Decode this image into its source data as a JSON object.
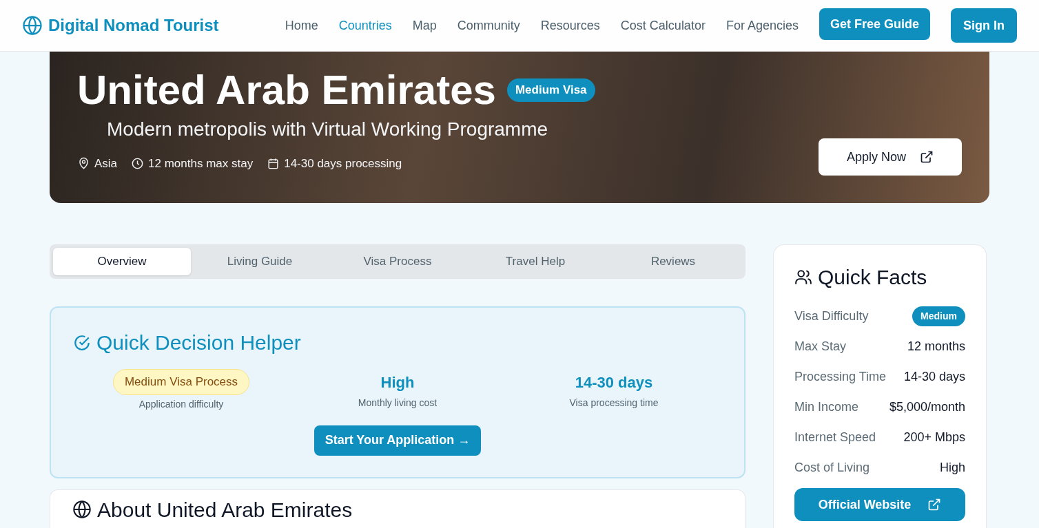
{
  "header": {
    "brand": "Digital Nomad Tourist",
    "nav": [
      {
        "label": "Home",
        "selected": false
      },
      {
        "label": "Countries",
        "selected": true
      },
      {
        "label": "Map",
        "selected": false
      },
      {
        "label": "Community",
        "selected": false
      },
      {
        "label": "Resources",
        "selected": false
      },
      {
        "label": "Cost Calculator",
        "selected": false
      },
      {
        "label": "For Agencies",
        "selected": false
      }
    ],
    "buttons": [
      "Get Free Guide",
      "Sign In"
    ]
  },
  "hero": {
    "title": "United Arab Emirates",
    "badge": "Medium Visa",
    "subtitle": "Modern metropolis with Virtual Working Programme",
    "meta": [
      {
        "kind": "location",
        "text": "Asia"
      },
      {
        "kind": "clock",
        "text": "12 months max stay"
      },
      {
        "kind": "calendar",
        "text": "14-30 days processing"
      }
    ],
    "apply_button": "Apply Now"
  },
  "tabs": [
    {
      "label": "Overview",
      "selected": true
    },
    {
      "label": "Living Guide",
      "selected": false
    },
    {
      "label": "Visa Process",
      "selected": false
    },
    {
      "label": "Travel Help",
      "selected": false
    },
    {
      "label": "Reviews",
      "selected": false
    }
  ],
  "helper": {
    "title": "Quick Decision Helper",
    "items": [
      {
        "kind": "pill",
        "value": "Medium Visa Process",
        "caption": "Application difficulty"
      },
      {
        "kind": "stat",
        "value": "High",
        "caption": "Monthly living cost"
      },
      {
        "kind": "stat",
        "value": "14-30 days",
        "caption": "Visa processing time"
      }
    ],
    "button": "Start Your Application →"
  },
  "about": {
    "title": "About United Arab Emirates"
  },
  "quick_facts": {
    "title": "Quick Facts",
    "rows": [
      {
        "kind": "badge",
        "label": "Visa Difficulty",
        "value": "Medium"
      },
      {
        "kind": "text",
        "label": "Max Stay",
        "value": "12 months"
      },
      {
        "kind": "text",
        "label": "Processing Time",
        "value": "14-30 days"
      },
      {
        "kind": "text",
        "label": "Min Income",
        "value": "$5,000/month"
      },
      {
        "kind": "text",
        "label": "Internet Speed",
        "value": "200+ Mbps"
      },
      {
        "kind": "text",
        "label": "Cost of Living",
        "value": "High"
      }
    ],
    "button": "Official Website"
  }
}
